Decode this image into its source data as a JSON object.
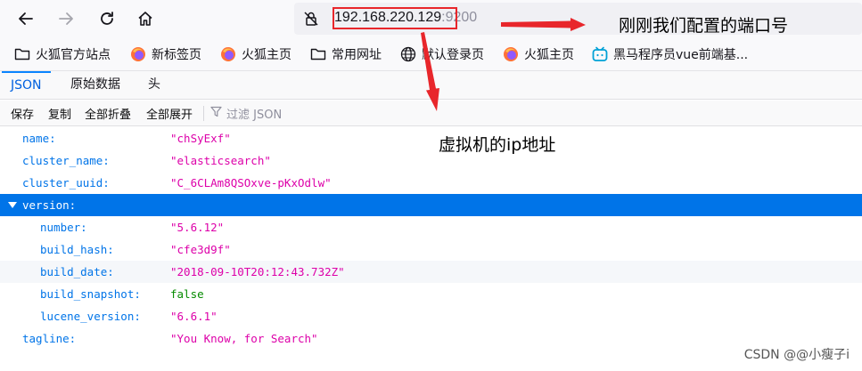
{
  "navbar": {
    "url_host": "192.168.220.129",
    "url_port": ":9200"
  },
  "annotations": {
    "port_note": "刚刚我们配置的端口号",
    "ip_note": "虚拟机的ip地址",
    "color": "#e8262b"
  },
  "bookmarks": [
    {
      "icon": "folder-icon",
      "label": "火狐官方站点"
    },
    {
      "icon": "firefox-icon",
      "label": "新标签页"
    },
    {
      "icon": "firefox-icon",
      "label": "火狐主页"
    },
    {
      "icon": "folder-icon",
      "label": "常用网址"
    },
    {
      "icon": "globe-icon",
      "label": "默认登录页"
    },
    {
      "icon": "firefox-icon",
      "label": "火狐主页"
    },
    {
      "icon": "bilibili-icon",
      "label": "黑马程序员vue前端基..."
    }
  ],
  "tabs": [
    {
      "label": "JSON",
      "active": true
    },
    {
      "label": "原始数据",
      "active": false
    },
    {
      "label": "头",
      "active": false
    }
  ],
  "toolbar": {
    "save": "保存",
    "copy": "复制",
    "collapse_all": "全部折叠",
    "expand_all": "全部展开",
    "filter_placeholder": "过滤 JSON"
  },
  "json_rows": [
    {
      "key": "name:",
      "value": "\"chSyExf\"",
      "type": "string",
      "indent": 0
    },
    {
      "key": "cluster_name:",
      "value": "\"elasticsearch\"",
      "type": "string",
      "indent": 0
    },
    {
      "key": "cluster_uuid:",
      "value": "\"C_6CLAm8QSOxve-pKxOdlw\"",
      "type": "string",
      "indent": 0
    },
    {
      "key": "version:",
      "value": "",
      "type": "object",
      "indent": 0,
      "expanded": true,
      "selected": true
    },
    {
      "key": "number:",
      "value": "\"5.6.12\"",
      "type": "string",
      "indent": 1
    },
    {
      "key": "build_hash:",
      "value": "\"cfe3d9f\"",
      "type": "string",
      "indent": 1
    },
    {
      "key": "build_date:",
      "value": "\"2018-09-10T20:12:43.732Z\"",
      "type": "string",
      "indent": 1
    },
    {
      "key": "build_snapshot:",
      "value": "false",
      "type": "bool",
      "indent": 1
    },
    {
      "key": "lucene_version:",
      "value": "\"6.6.1\"",
      "type": "string",
      "indent": 1
    },
    {
      "key": "tagline:",
      "value": "\"You Know, for Search\"",
      "type": "string",
      "indent": 0
    }
  ],
  "watermark": "CSDN @@小瘦子i"
}
